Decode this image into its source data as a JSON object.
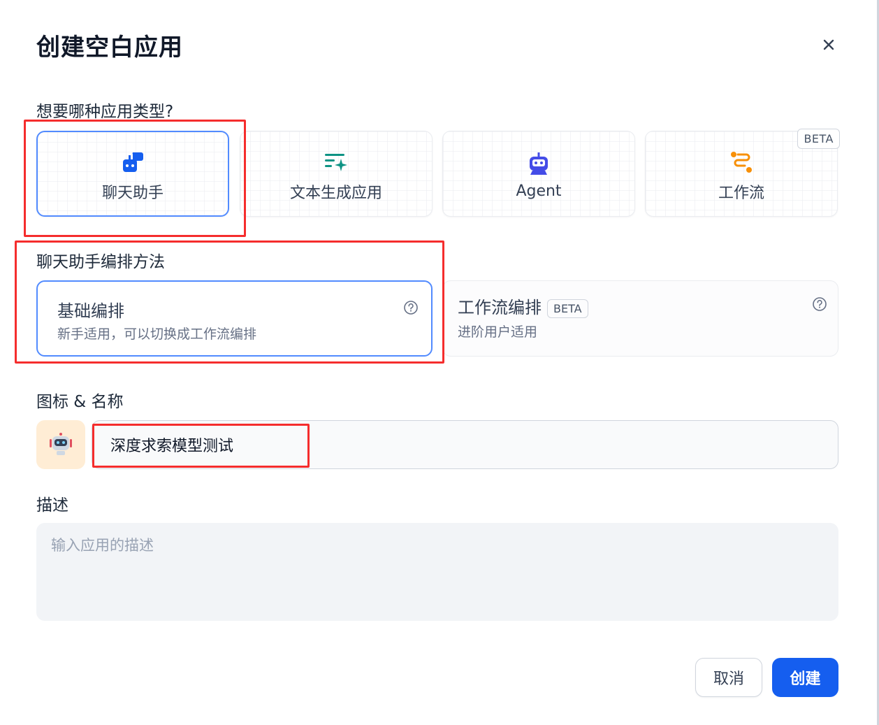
{
  "dialog": {
    "title": "创建空白应用",
    "close_icon": "close-icon"
  },
  "app_type": {
    "label": "想要哪种应用类型?",
    "options": [
      {
        "label": "聊天助手",
        "icon": "chat-bot-icon",
        "selected": true
      },
      {
        "label": "文本生成应用",
        "icon": "text-sparkle-icon",
        "selected": false
      },
      {
        "label": "Agent",
        "icon": "robot-icon",
        "selected": false
      },
      {
        "label": "工作流",
        "icon": "workflow-icon",
        "selected": false,
        "badge": "BETA"
      }
    ]
  },
  "orchestration": {
    "label": "聊天助手编排方法",
    "options": [
      {
        "title": "基础编排",
        "desc": "新手适用，可以切换成工作流编排",
        "selected": true
      },
      {
        "title": "工作流编排",
        "badge": "BETA",
        "desc": "进阶用户适用",
        "selected": false
      }
    ]
  },
  "icon_name": {
    "label": "图标 & 名称",
    "icon": "robot-avatar-icon",
    "value": "深度求索模型测试"
  },
  "description": {
    "label": "描述",
    "placeholder": "输入应用的描述"
  },
  "footer": {
    "cancel_label": "取消",
    "create_label": "创建"
  },
  "colors": {
    "accent": "#155eef",
    "selected_border": "#528bff",
    "annotation": "#f52d2d",
    "icon_bg": "#ffedd5"
  }
}
